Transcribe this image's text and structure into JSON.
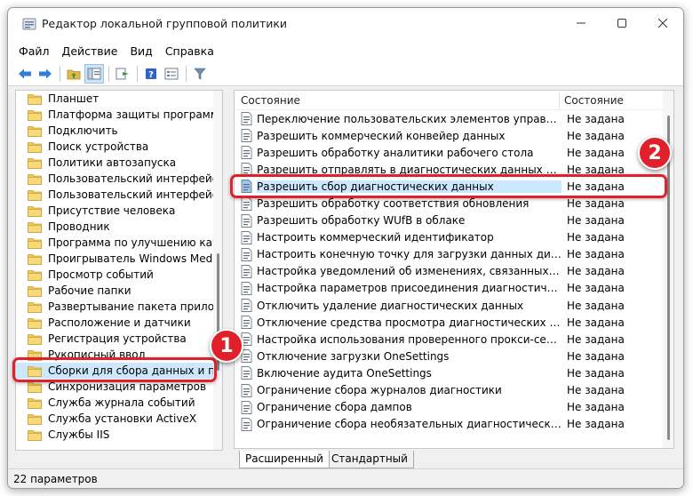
{
  "window": {
    "title": "Редактор локальной групповой политики"
  },
  "menu": [
    "Файл",
    "Действие",
    "Вид",
    "Справка"
  ],
  "tree": {
    "items": [
      {
        "label": "Планшет"
      },
      {
        "label": "Платформа защиты программного обеспечения"
      },
      {
        "label": "Подключить"
      },
      {
        "label": "Поиск устройства"
      },
      {
        "label": "Политики автозапуска"
      },
      {
        "label": "Пользовательский интерфейс границы"
      },
      {
        "label": "Пользовательский интерфейс учетных данных"
      },
      {
        "label": "Присутствие человека"
      },
      {
        "label": "Проводник"
      },
      {
        "label": "Программа по улучшению качества"
      },
      {
        "label": "Проигрыватель Windows Media"
      },
      {
        "label": "Просмотр событий"
      },
      {
        "label": "Рабочие папки"
      },
      {
        "label": "Развертывание пакета приложения"
      },
      {
        "label": "Расположение и датчики"
      },
      {
        "label": "Регистрация устройства"
      },
      {
        "label": "Рукописный ввод"
      },
      {
        "label": "Сборки для сбора данных и предварительные сборки",
        "selected": true
      },
      {
        "label": "Синхронизация параметров"
      },
      {
        "label": "Служба журнала событий"
      },
      {
        "label": "Служба установки ActiveX"
      },
      {
        "label": "Службы IIS"
      }
    ]
  },
  "list": {
    "col_name": "Состояние",
    "col_state": "Состояние",
    "rows": [
      {
        "name": "Переключение пользовательских элементов управления",
        "state": "Не задана"
      },
      {
        "name": "Разрешить коммерческий конвейер данных",
        "state": "Не задана"
      },
      {
        "name": "Разрешить обработку аналитики рабочего стола",
        "state": "Не задана"
      },
      {
        "name": "Разрешить отправлять в диагностических данных Windows",
        "state": "Не задана"
      },
      {
        "name": "Разрешить сбор диагностических данных",
        "state": "Не задана",
        "selected": true
      },
      {
        "name": "Разрешить обработку соответствия обновления",
        "state": "Не задана"
      },
      {
        "name": "Разрешить обработку WUfB в облаке",
        "state": "Не задана"
      },
      {
        "name": "Настроить коммерческий идентификатор",
        "state": "Не задана"
      },
      {
        "name": "Настроить конечную точку для загрузки данных диагностики",
        "state": "Не задана"
      },
      {
        "name": "Настройка уведомлений об изменениях, связанных с пр...",
        "state": "Не задана"
      },
      {
        "name": "Настройка параметров присоединения диагностических",
        "state": "Не задана"
      },
      {
        "name": "Отключить удаление диагностических данных",
        "state": "Не задана"
      },
      {
        "name": "Отключение средства просмотра диагностических данных",
        "state": "Не задана"
      },
      {
        "name": "Настройка использования проверенного прокси-сервера",
        "state": "Не задана"
      },
      {
        "name": "Отключение загрузки OneSettings",
        "state": "Не задана"
      },
      {
        "name": "Включение аудита OneSettings",
        "state": "Не задана"
      },
      {
        "name": "Ограничение сбора журналов диагностики",
        "state": "Не задана"
      },
      {
        "name": "Ограничение сбора дампов",
        "state": "Не задана"
      },
      {
        "name": "Ограничение сбора необязательных диагностических да...",
        "state": "Не задана"
      }
    ]
  },
  "tabs": [
    "Расширенный",
    "Стандартный"
  ],
  "status": "22 параметров",
  "callouts": [
    "1",
    "2"
  ],
  "colors": {
    "highlight": "#e0212b",
    "selection": "#cce8ff",
    "folder": "#f2c94c"
  }
}
